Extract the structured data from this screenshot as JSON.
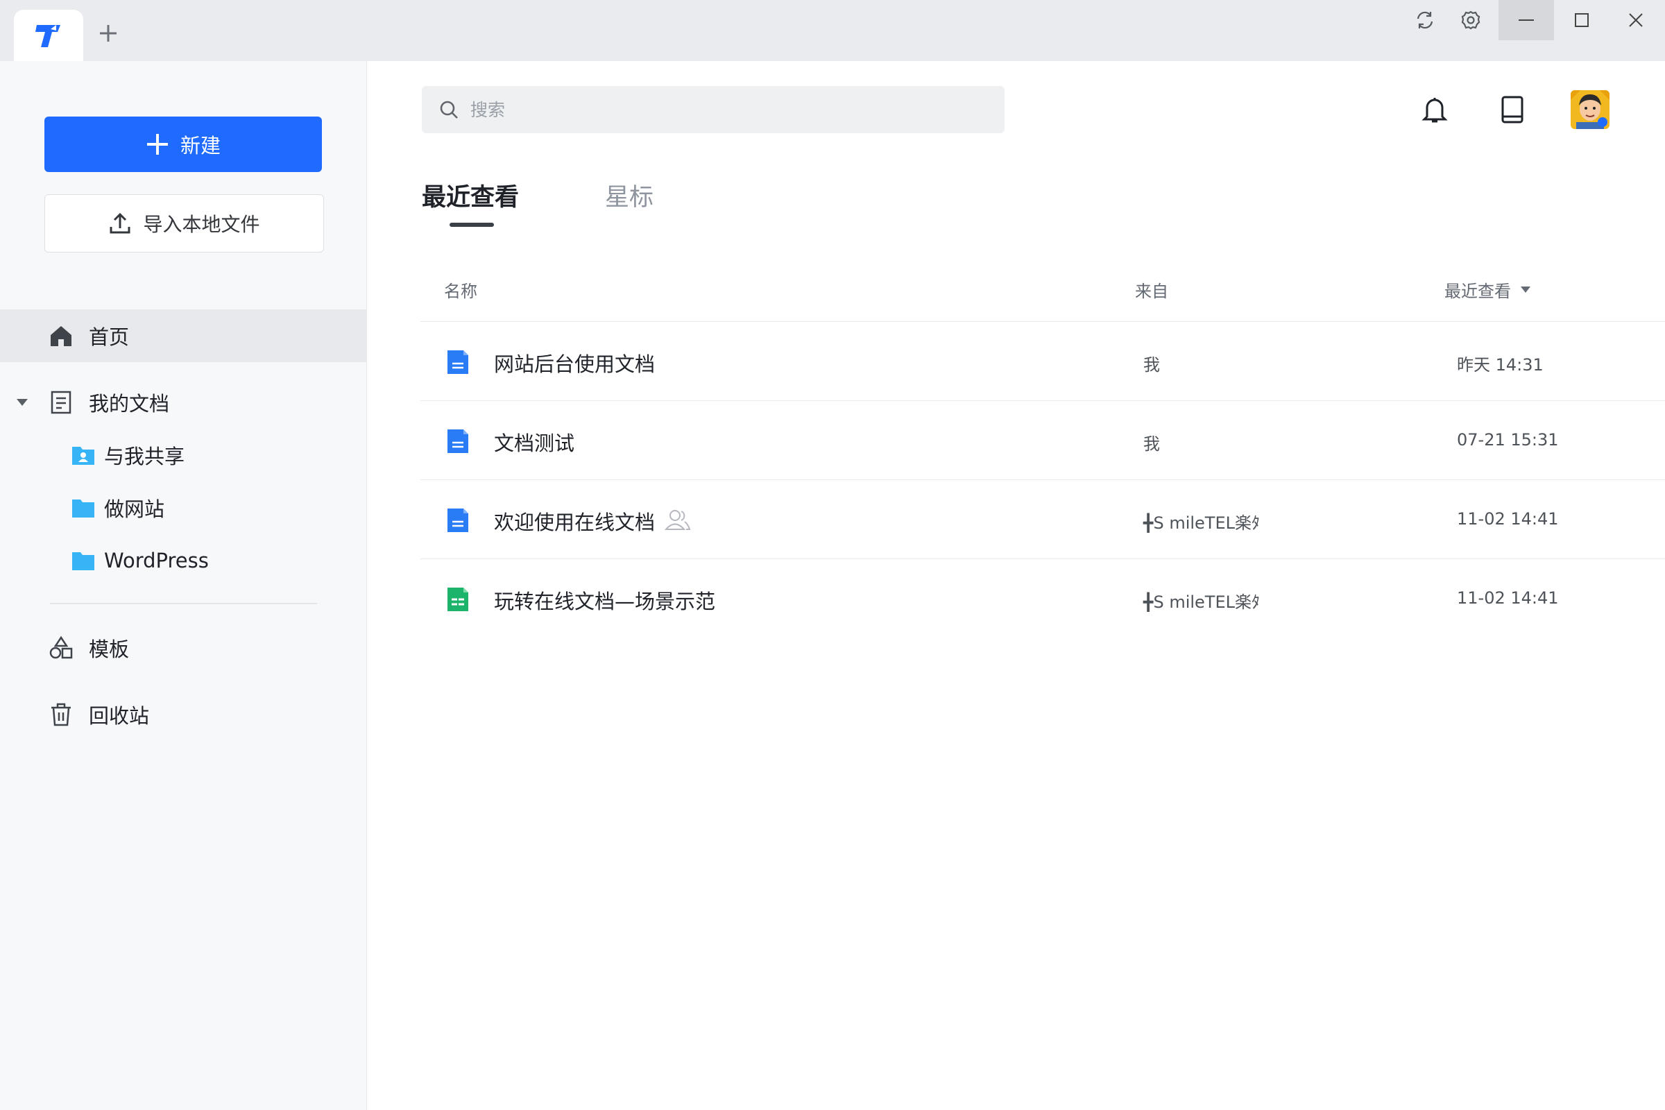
{
  "titlebar": {
    "app_icon": "tencent-docs-logo",
    "new_tab_icon": "plus-icon",
    "controls": [
      "sync-icon",
      "settings-icon",
      "minimize-icon",
      "maximize-icon",
      "close-icon"
    ]
  },
  "sidebar": {
    "new_button": "新建",
    "import_button": "导入本地文件",
    "items": [
      {
        "label": "首页",
        "icon": "home-icon"
      },
      {
        "label": "我的文档",
        "icon": "document-icon"
      },
      {
        "label": "与我共享",
        "icon": "shared-folder-icon"
      },
      {
        "label": "做网站",
        "icon": "folder-icon"
      },
      {
        "label": "WordPress",
        "icon": "folder-icon"
      },
      {
        "label": "模板",
        "icon": "template-icon"
      },
      {
        "label": "回收站",
        "icon": "trash-icon"
      }
    ]
  },
  "search": {
    "placeholder": "搜索"
  },
  "header_icons": [
    "bell-icon",
    "tablet-icon",
    "avatar"
  ],
  "tabs": [
    {
      "label": "最近查看",
      "active": true
    },
    {
      "label": "星标",
      "active": false
    }
  ],
  "table": {
    "columns": {
      "name": "名称",
      "from": "来自",
      "sort": "最近查看"
    },
    "rows": [
      {
        "name": "网站后台使用文档",
        "type": "doc",
        "from": "我",
        "time": "昨天 14:31"
      },
      {
        "name": "文档测试",
        "type": "doc",
        "from": "我",
        "time": "07-21 15:31"
      },
      {
        "name": "欢迎使用在线文档",
        "type": "doc",
        "shared": true,
        "from": "╋S mileTEL楽ﾀ",
        "time": "11-02 14:41"
      },
      {
        "name": "玩转在线文档—场景示范",
        "type": "sheet",
        "from": "╋S mileTEL楽ﾀ",
        "time": "11-02 14:41"
      }
    ]
  },
  "colors": {
    "primary": "#1f6bff",
    "sheet": "#1bb46a",
    "doc": "#2a7cf6",
    "folder": "#36b4f5"
  }
}
